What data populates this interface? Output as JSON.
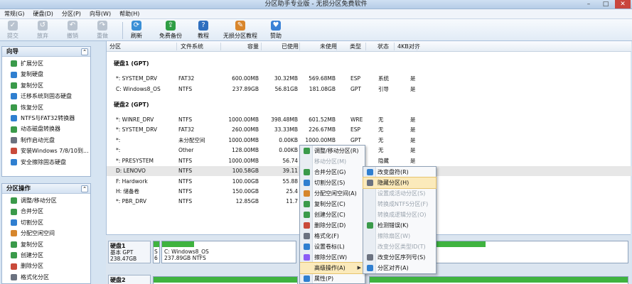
{
  "window": {
    "title": "分区助手专业版 - 无损分区免费软件",
    "min": "–",
    "max": "□",
    "close": "✕"
  },
  "menubar": [
    "常规(G)",
    "硬盘(D)",
    "分区(P)",
    "向导(W)",
    "帮助(H)"
  ],
  "toolbar": [
    {
      "label": "提交",
      "icon": "commit-icon",
      "enabled": false
    },
    {
      "label": "放弃",
      "icon": "discard-icon",
      "enabled": false
    },
    {
      "label": "撤销",
      "icon": "undo-icon",
      "enabled": false
    },
    {
      "label": "重做",
      "icon": "redo-icon",
      "enabled": false
    },
    {
      "label": "刷新",
      "icon": "refresh-icon",
      "enabled": true,
      "color": "#3a8fd6"
    },
    {
      "label": "免费备份",
      "icon": "backup-icon",
      "enabled": true,
      "color": "#2f9e44"
    },
    {
      "label": "教程",
      "icon": "tutorial-icon",
      "enabled": true,
      "color": "#2f6fbf"
    },
    {
      "label": "无损分区教程",
      "icon": "lossless-tutorial-icon",
      "enabled": true,
      "color": "#d9862c"
    },
    {
      "label": "赞助",
      "icon": "sponsor-icon",
      "enabled": true,
      "color": "#3b82d6"
    }
  ],
  "sidebar": {
    "wizard": {
      "title": "向导",
      "items": [
        "扩展分区",
        "复制硬盘",
        "复制分区",
        "迁移系统到固态硬盘",
        "恢复分区",
        "NTFS与FAT32转换器",
        "动态磁盘转换器",
        "制作启动光盘",
        "安装Windows 7/8/10到...",
        "安全擦除固态硬盘"
      ]
    },
    "partition_ops": {
      "title": "分区操作",
      "items": [
        "调整/移动分区",
        "合并分区",
        "切割分区",
        "分配空闲空间",
        "复制分区",
        "创建分区",
        "删除分区",
        "格式化分区"
      ]
    }
  },
  "list": {
    "columns": [
      "分区",
      "文件系统",
      "容量",
      "已使用",
      "未使用",
      "类型",
      "状态",
      "4KB对齐"
    ],
    "disks": [
      {
        "title": "硬盘1 (GPT)",
        "rows": [
          [
            "*: SYSTEM_DRV",
            "FAT32",
            "600.00MB",
            "30.32MB",
            "569.68MB",
            "ESP",
            "系统",
            "是"
          ],
          [
            "C: Windows8_OS",
            "NTFS",
            "237.89GB",
            "56.81GB",
            "181.08GB",
            "GPT",
            "引导",
            "是"
          ]
        ]
      },
      {
        "title": "硬盘2 (GPT)",
        "rows": [
          [
            "*: WINRE_DRV",
            "NTFS",
            "1000.00MB",
            "398.48MB",
            "601.52MB",
            "WRE",
            "无",
            "是"
          ],
          [
            "*: SYSTEM_DRV",
            "FAT32",
            "260.00MB",
            "33.33MB",
            "226.67MB",
            "ESP",
            "无",
            "是"
          ],
          [
            "*:",
            "未分配空间",
            "1000.00MB",
            "0.00KB",
            "1000.00MB",
            "GPT",
            "无",
            "是"
          ],
          [
            "*:",
            "Other",
            "128.00MB",
            "0.00KB",
            "",
            "",
            "无",
            "是"
          ],
          [
            "*: PRESYSTEM",
            "NTFS",
            "1000.00MB",
            "56.74",
            "",
            "",
            "隐藏",
            "是"
          ],
          [
            "D: LENOVO",
            "NTFS",
            "100.58GB",
            "39.11",
            "",
            "",
            "",
            ""
          ],
          [
            "F: Hardwork",
            "NTFS",
            "100.00GB",
            "55.88",
            "",
            "",
            "",
            ""
          ],
          [
            "H: 储备卷",
            "NTFS",
            "150.00GB",
            "25.4",
            "",
            "",
            "",
            ""
          ],
          [
            "*: PBR_DRV",
            "NTFS",
            "12.85GB",
            "11.7",
            "",
            "",
            "",
            ""
          ]
        ]
      }
    ]
  },
  "diskmap": [
    {
      "title": "硬盘1",
      "scheme": "基本 GPT",
      "size": "238.47GB",
      "prefix": "S",
      "prefix2": "6",
      "partition": "C: Windows8_OS",
      "part_detail": "237.89GB NTFS",
      "fill": 0.24
    },
    {
      "title": "硬盘2",
      "scheme": "",
      "size": "",
      "prefix": "",
      "partition": "",
      "part_detail": ""
    }
  ],
  "context_menu": {
    "items": [
      {
        "label": "调整/移动分区(R)",
        "enabled": true,
        "color": "#3a9a4a"
      },
      {
        "label": "移动分区(M)",
        "enabled": false
      },
      {
        "label": "合并分区(G)",
        "enabled": true,
        "color": "#3a9a4a"
      },
      {
        "label": "切割分区(S)",
        "enabled": true,
        "color": "#2f7fd0"
      },
      {
        "label": "分配空闲空间(A)",
        "enabled": true,
        "color": "#d6862c"
      },
      {
        "label": "复制分区(C)",
        "enabled": true,
        "color": "#3a9a4a"
      },
      {
        "label": "创建分区(C)",
        "enabled": true,
        "color": "#3a9a4a"
      },
      {
        "label": "删除分区(D)",
        "enabled": true,
        "color": "#c94a3a"
      },
      {
        "label": "格式化(F)",
        "enabled": true,
        "color": "#6b7280"
      },
      {
        "label": "设置卷标(L)",
        "enabled": true,
        "color": "#2f7fd0"
      },
      {
        "label": "擦除分区(W)",
        "enabled": true,
        "color": "#8b5cf6"
      },
      {
        "label": "高级操作(A)",
        "enabled": true,
        "highlighted": true,
        "submenu": true
      },
      {
        "label": "属性(P)",
        "enabled": true,
        "color": "#2f7fd0"
      }
    ]
  },
  "sub_menu": {
    "items": [
      {
        "label": "改变盘符(R)",
        "enabled": true,
        "color": "#2f7fd0"
      },
      {
        "label": "隐藏分区(H)",
        "enabled": true,
        "highlighted": true,
        "color": "#6b7280"
      },
      {
        "label": "设置成活动分区(S)",
        "enabled": false
      },
      {
        "label": "转换成NTFS分区(F)",
        "enabled": false
      },
      {
        "label": "转换成逻辑分区(O)",
        "enabled": false
      },
      {
        "label": "检测错误(K)",
        "enabled": true,
        "color": "#3a9a4a"
      },
      {
        "label": "擦除扇区(W)",
        "enabled": false
      },
      {
        "label": "改变分区类型ID(T)",
        "enabled": false
      },
      {
        "label": "改变分区序列号(S)",
        "enabled": true,
        "color": "#6b7280"
      },
      {
        "label": "分区对齐(A)",
        "enabled": true,
        "color": "#2f7fd0"
      }
    ]
  }
}
